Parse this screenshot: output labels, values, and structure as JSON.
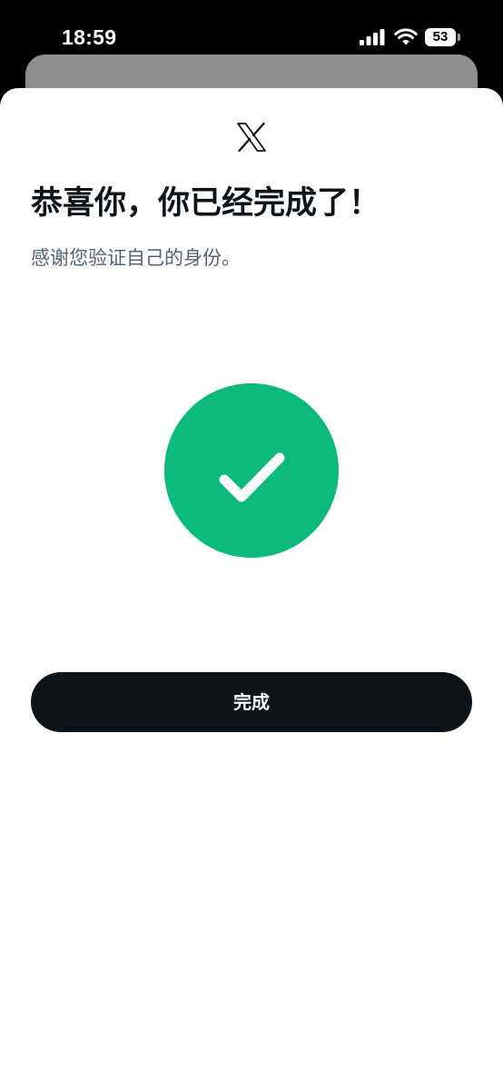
{
  "status_bar": {
    "time": "18:59",
    "battery_level": "53",
    "signal_icon": "cellular-signal-icon",
    "wifi_icon": "wifi-icon",
    "battery_icon": "battery-icon"
  },
  "header": {
    "logo_icon": "x-logo-icon"
  },
  "content": {
    "title": "恭喜你，你已经完成了！",
    "subtitle": "感谢您验证自己的身份。",
    "status_icon": "checkmark-icon"
  },
  "actions": {
    "done_label": "完成"
  },
  "colors": {
    "success": "#0cba7c",
    "button_bg": "#0f1419",
    "title_text": "#0f1419",
    "subtitle_text": "#536471",
    "background_sheet": "#8e8e8e"
  }
}
